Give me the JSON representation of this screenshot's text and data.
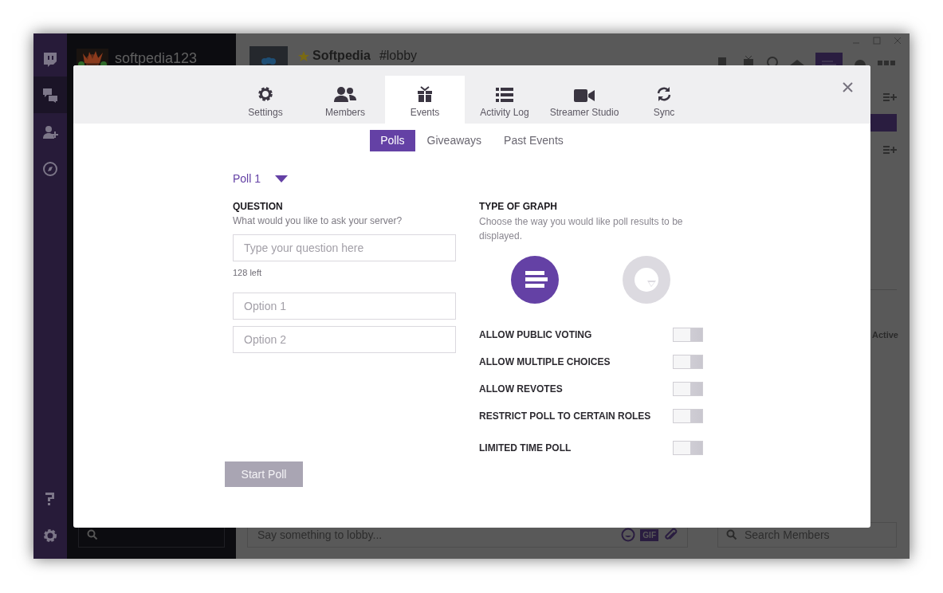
{
  "app": {
    "user_name": "softpedia123",
    "server_name": "Softpedia",
    "channel": "#lobby",
    "member_status": "Active",
    "message_placeholder": "Say something to lobby...",
    "gif_label": "GIF",
    "member_search_placeholder": "Search Members"
  },
  "modal": {
    "tabs": [
      {
        "label": "Settings",
        "selected": false
      },
      {
        "label": "Members",
        "selected": false
      },
      {
        "label": "Events",
        "selected": true
      },
      {
        "label": "Activity Log",
        "selected": false
      },
      {
        "label": "Streamer Studio",
        "selected": false
      },
      {
        "label": "Sync",
        "selected": false
      }
    ],
    "subtabs": [
      {
        "label": "Polls",
        "selected": true
      },
      {
        "label": "Giveaways",
        "selected": false
      },
      {
        "label": "Past Events",
        "selected": false
      }
    ],
    "poll_select": "Poll 1",
    "question": {
      "title": "QUESTION",
      "hint": "What would you like to ask your server?",
      "placeholder": "Type your question here",
      "remaining": "128 left"
    },
    "options": [
      {
        "placeholder": "Option 1"
      },
      {
        "placeholder": "Option 2"
      }
    ],
    "graph": {
      "title": "TYPE OF GRAPH",
      "hint": "Choose the way you would like poll results to be displayed.",
      "types": [
        {
          "kind": "bar",
          "selected": true
        },
        {
          "kind": "pie",
          "selected": false
        }
      ]
    },
    "toggles": [
      {
        "label": "ALLOW PUBLIC VOTING",
        "on": false
      },
      {
        "label": "ALLOW MULTIPLE CHOICES",
        "on": false
      },
      {
        "label": "ALLOW REVOTES",
        "on": false
      },
      {
        "label": "RESTRICT POLL TO CERTAIN ROLES",
        "on": false
      },
      {
        "label": "LIMITED TIME POLL",
        "on": false
      }
    ],
    "start_button": {
      "label": "Start Poll",
      "disabled": true
    }
  }
}
